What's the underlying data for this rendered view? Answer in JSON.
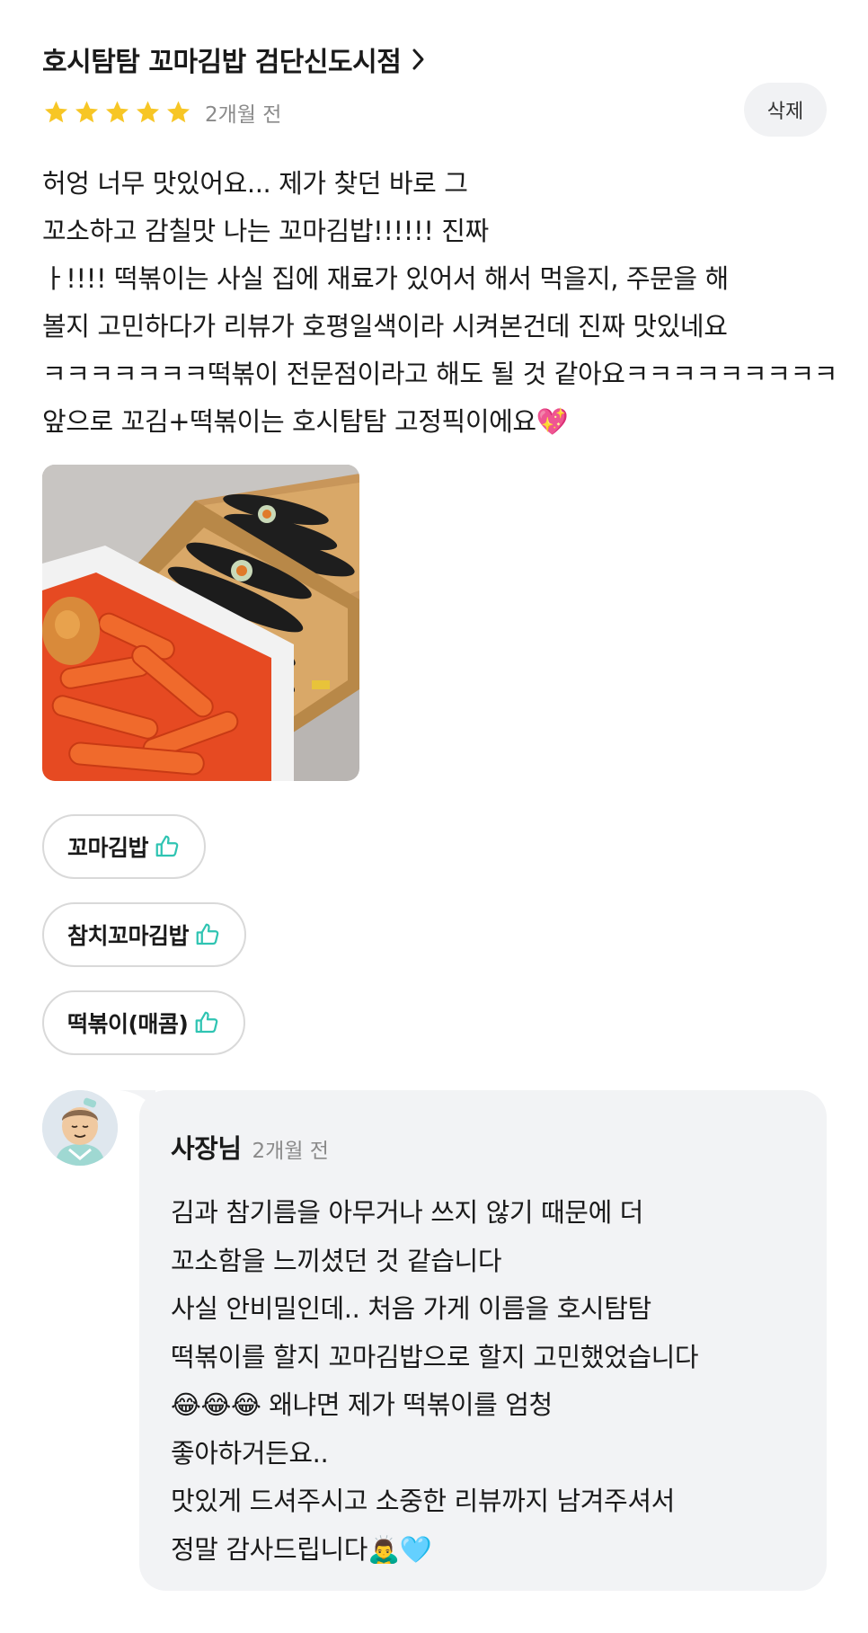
{
  "store": {
    "name": "호시탐탐 꼬마김밥 검단신도시점",
    "chevron_icon": "chevron-right-icon"
  },
  "review": {
    "rating": 5,
    "rating_max": 5,
    "star_color": "#f7c625",
    "time": "2개월 전",
    "delete_label": "삭제",
    "lines": [
      "허엉 너무 맛있어요... 제가 찾던 바로 그",
      "꼬소하고 감칠맛 나는 꼬마김밥!!!!!! 진짜",
      "ㅏ!!!! 떡볶이는 사실 집에 재료가 있어서 해서 먹을지, 주문을 해",
      "볼지 고민하다가 리뷰가 호평일색이라 시켜본건데 진짜 맛있네요",
      "ㅋㅋㅋㅋㅋㅋㅋ떡볶이 전문점이라고 해도 될 것 같아요ㅋㅋㅋㅋㅋㅋㅋㅋㅋ",
      "앞으로 꼬김+떡볶이는 호시탐탐 고정픽이에요💖"
    ],
    "menu_tags": [
      {
        "label": "꼬마김밥",
        "icon": "thumbs-up-icon"
      },
      {
        "label": "참치꼬마김밥",
        "icon": "thumbs-up-icon"
      },
      {
        "label": "떡볶이(매콤)",
        "icon": "thumbs-up-icon"
      }
    ],
    "accent_color": "#2fc4b2"
  },
  "reply": {
    "author": "사장님",
    "time": "2개월 전",
    "lines": [
      "김과 참기름을 아무거나 쓰지 않기 때문에 더",
      "꼬소함을 느끼셨던 것 같습니다",
      "사실 안비밀인데.. 처음 가게 이름을 호시탐탐",
      "떡볶이를 할지 꼬마김밥으로 할지 고민했었습니다",
      "😂😂😂 왜냐면 제가 떡볶이를 엄청",
      "좋아하거든요..",
      "맛있게 드셔주시고 소중한 리뷰까지 남겨주셔서",
      "정말 감사드립니다🙇‍♂️🩵"
    ],
    "background_color": "#f2f3f5"
  }
}
